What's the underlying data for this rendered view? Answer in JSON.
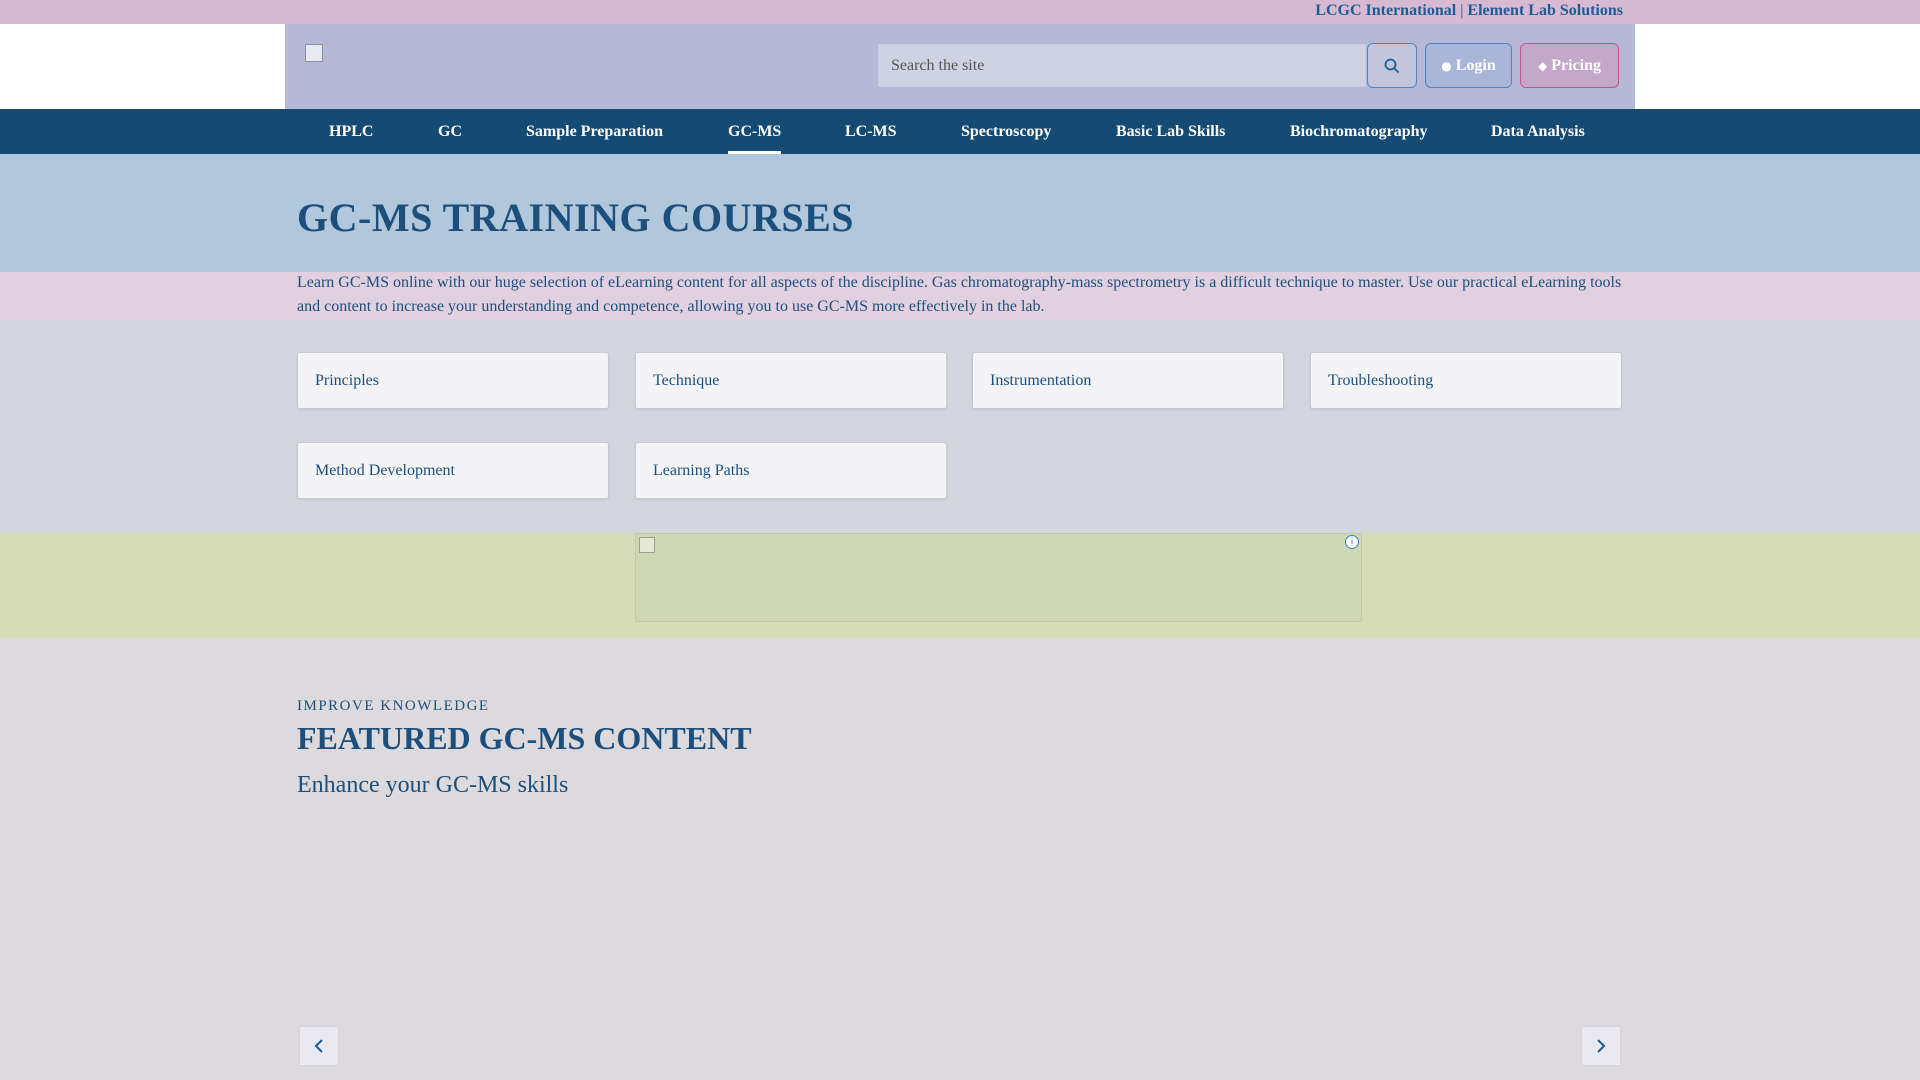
{
  "topbar": {
    "link1": "LCGC International",
    "separator": "|",
    "link2": "Element Lab Solutions"
  },
  "header": {
    "search_placeholder": "Search the site",
    "search_icon": "search-icon",
    "login_label": "Login",
    "login_icon": "user-icon",
    "pricing_label": "Pricing",
    "pricing_icon": "tag-icon"
  },
  "nav": {
    "items": [
      {
        "label": "HPLC"
      },
      {
        "label": "GC"
      },
      {
        "label": "Sample Preparation"
      },
      {
        "label": "GC-MS"
      },
      {
        "label": "LC-MS"
      },
      {
        "label": "Spectroscopy"
      },
      {
        "label": "Basic Lab Skills"
      },
      {
        "label": "Biochromatography"
      },
      {
        "label": "Data Analysis"
      }
    ],
    "active": "GC-MS"
  },
  "hero": {
    "title": "GC-MS TRAINING COURSES"
  },
  "intro": "Learn GC-MS online with our huge selection of eLearning content for all aspects of the discipline. Gas chromatography-mass spectrometry is a difficult technique to master. Use our practical eLearning tools and content to increase your understanding and competence, allowing you to use GC-MS more effectively in the lab.",
  "cards": [
    {
      "label": "Principles"
    },
    {
      "label": "Technique"
    },
    {
      "label": "Instrumentation"
    },
    {
      "label": "Troubleshooting"
    },
    {
      "label": "Method Development"
    },
    {
      "label": "Learning Paths"
    }
  ],
  "ad": {
    "info_icon": "info-icon"
  },
  "featured": {
    "eyebrow": "IMPROVE KNOWLEDGE",
    "title": "FEATURED GC-MS CONTENT",
    "subtitle": "Enhance your GC-MS skills",
    "prev_icon": "chevron-left-icon",
    "next_icon": "chevron-right-icon"
  },
  "colors": {
    "brand_blue": "#154a73",
    "accent_pink": "#c3528d",
    "link_blue": "#1d5d96"
  }
}
